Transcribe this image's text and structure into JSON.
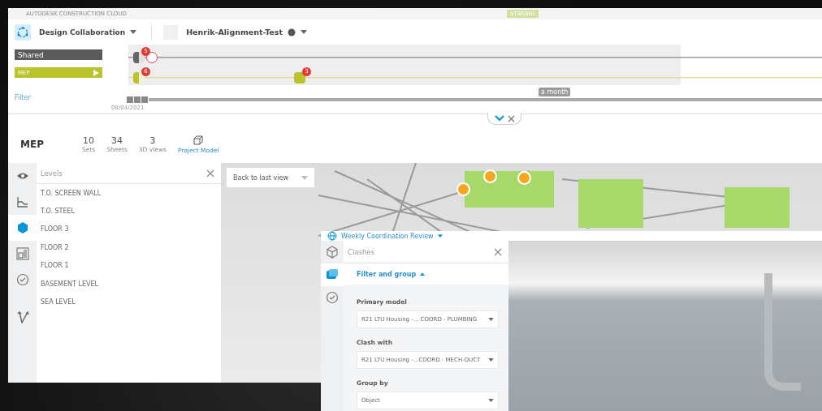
{
  "brand": "AUTODESK CONSTRUCTION CLOUD",
  "environment_badge": "STAGING",
  "header": {
    "module": "Design Collaboration",
    "project": "Henrik-Alignment-Test"
  },
  "timeline": {
    "packages": [
      {
        "label": "Shared",
        "kind": "shared"
      },
      {
        "label": "MEP",
        "kind": "team"
      }
    ],
    "filter": "Filter",
    "tracks": [
      {
        "kind": "shared",
        "markers": [
          {
            "badge": "5"
          }
        ]
      },
      {
        "kind": "team",
        "markers": [
          {
            "badge": "6"
          },
          {
            "badge": "3"
          }
        ]
      }
    ],
    "tooltip": "a month",
    "date": "08/04/2021"
  },
  "summary": {
    "title": "MEP",
    "stats": [
      {
        "value": "10",
        "label": "Sets"
      },
      {
        "value": "34",
        "label": "Sheets"
      },
      {
        "value": "3",
        "label": "3D views"
      }
    ],
    "link": "Project Model"
  },
  "rail": [
    {
      "kind": "eye",
      "selected": false
    },
    {
      "kind": "sheet",
      "selected": false
    },
    {
      "kind": "levels",
      "selected": true
    },
    {
      "kind": "plan",
      "selected": false
    },
    {
      "kind": "check",
      "selected": false
    },
    {
      "kind": "arrows",
      "selected": false
    }
  ],
  "levels": {
    "title": "Levels",
    "items": [
      "T.O. SCREEN WALL",
      "T.O. STEEL",
      "FLOOR 3",
      "FLOOR 2",
      "FLOOR 1",
      "BASEMENT LEVEL",
      "SEA LEVEL"
    ]
  },
  "viewer": {
    "view_menu": "Back to last view"
  },
  "review": {
    "title": "Weekly Coordination Review",
    "rail": [
      {
        "kind": "cube",
        "selected": false
      },
      {
        "kind": "clashes",
        "selected": true
      },
      {
        "kind": "check",
        "selected": false
      }
    ],
    "panel_title": "Clashes",
    "section": "Filter and group",
    "fields": [
      {
        "label": "Primary model",
        "value": "R21 LTU Housing -... COORD - PLUMBING"
      },
      {
        "label": "Clash with",
        "value": "R21 LTU Housing -...COORD - MECH-DUCT"
      },
      {
        "label": "Group by",
        "value": "Object"
      }
    ]
  }
}
